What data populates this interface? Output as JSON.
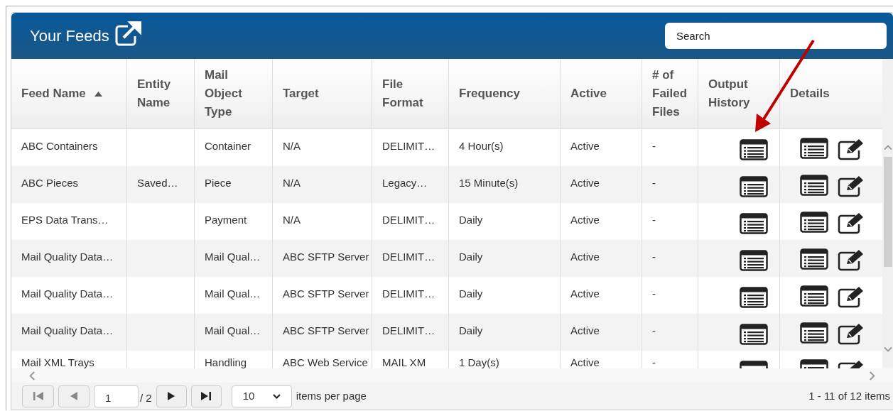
{
  "header": {
    "title": "Your Feeds",
    "search": {
      "placeholder": "Search"
    }
  },
  "table": {
    "columns": [
      {
        "label": "Feed Name",
        "sorted": true
      },
      {
        "label": "Entity Name",
        "sorted": false
      },
      {
        "label": "Mail Object Type",
        "sorted": false
      },
      {
        "label": "Target",
        "sorted": false
      },
      {
        "label": "File Format",
        "sorted": false
      },
      {
        "label": "Frequency",
        "sorted": false
      },
      {
        "label": "Active",
        "sorted": false
      },
      {
        "label": "# of Failed Files",
        "sorted": false
      },
      {
        "label": "Output History",
        "sorted": false
      },
      {
        "label": "Details",
        "sorted": false
      }
    ],
    "rows": [
      {
        "cells": [
          "ABC Containers",
          "",
          "Container",
          "N/A",
          "DELIMIT…",
          "4 Hour(s)",
          "Active",
          "-"
        ]
      },
      {
        "cells": [
          "ABC Pieces",
          "Saved…",
          "Piece",
          "N/A",
          "Legacy…",
          "15 Minute(s)",
          "Active",
          "-"
        ]
      },
      {
        "cells": [
          "EPS Data Trans…",
          "",
          "Payment",
          "N/A",
          "DELIMIT…",
          "Daily",
          "Active",
          "-"
        ]
      },
      {
        "cells": [
          "Mail Quality Data…",
          "",
          "Mail Qual…",
          "ABC SFTP Server",
          "DELIMIT…",
          "Daily",
          "Active",
          "-"
        ]
      },
      {
        "cells": [
          "Mail Quality Data…",
          "",
          "Mail Qual…",
          "ABC SFTP Server",
          "DELIMIT…",
          "Daily",
          "Active",
          "-"
        ]
      },
      {
        "cells": [
          "Mail Quality Data…",
          "",
          "Mail Qual…",
          "ABC SFTP Server",
          "DELIMIT…",
          "Daily",
          "Active",
          "-"
        ]
      },
      {
        "cells": [
          "Mail XML Trays",
          "",
          "Handling",
          "ABC Web Service",
          "MAIL XM",
          "1 Day(s)",
          "Active",
          "-"
        ]
      }
    ]
  },
  "pager": {
    "page": "1",
    "total": "/ 2",
    "page_size": "10",
    "page_size_label": "items per page",
    "summary": "1 - 11 of 12 items"
  }
}
